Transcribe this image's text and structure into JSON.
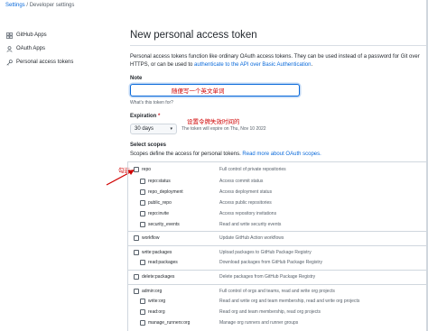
{
  "breadcrumb": {
    "settings": "Settings",
    "separator": "/",
    "current": "Developer settings"
  },
  "sidebar": {
    "items": [
      {
        "label": "GitHub Apps",
        "icon": "grid-icon"
      },
      {
        "label": "OAuth Apps",
        "icon": "person-icon"
      },
      {
        "label": "Personal access tokens",
        "icon": "key-icon"
      }
    ]
  },
  "main": {
    "title": "New personal access token",
    "intro_part1": "Personal access tokens function like ordinary OAuth access tokens. They can be used instead of a password for Git over HTTPS, or can be used to ",
    "intro_link": "authenticate to the API over Basic Authentication",
    "intro_part2": ".",
    "note_label": "Note",
    "note_value": "",
    "note_hint": "What's this token for?",
    "expiration_label": "Expiration",
    "expiration_required": "*",
    "expiration_value": "30 days",
    "expiration_text": "The token will expire on Thu, Nov 10 2022",
    "scopes_label": "Select scopes",
    "scopes_desc": "Scopes define the access for personal tokens. ",
    "scopes_link": "Read more about OAuth scopes."
  },
  "annotations": {
    "note": "随便写一个英文单词",
    "expiration": "设置令牌失效时间的",
    "check": "勾选"
  },
  "scopes": [
    {
      "name": "repo",
      "desc": "Full control of private repositories",
      "level": 0,
      "sep": true
    },
    {
      "name": "repo:status",
      "desc": "Access commit status",
      "level": 1,
      "sep": false
    },
    {
      "name": "repo_deployment",
      "desc": "Access deployment status",
      "level": 1,
      "sep": false
    },
    {
      "name": "public_repo",
      "desc": "Access public repositories",
      "level": 1,
      "sep": false
    },
    {
      "name": "repo:invite",
      "desc": "Access repository invitations",
      "level": 1,
      "sep": false
    },
    {
      "name": "security_events",
      "desc": "Read and write security events",
      "level": 1,
      "sep": false
    },
    {
      "name": "workflow",
      "desc": "Update GitHub Action workflows",
      "level": 0,
      "sep": true
    },
    {
      "name": "write:packages",
      "desc": "Upload packages to GitHub Package Registry",
      "level": 0,
      "sep": true
    },
    {
      "name": "read:packages",
      "desc": "Download packages from GitHub Package Registry",
      "level": 1,
      "sep": false
    },
    {
      "name": "delete:packages",
      "desc": "Delete packages from GitHub Package Registry",
      "level": 0,
      "sep": true
    },
    {
      "name": "admin:org",
      "desc": "Full control of orgs and teams, read and write org projects",
      "level": 0,
      "sep": true
    },
    {
      "name": "write:org",
      "desc": "Read and write org and team membership, read and write org projects",
      "level": 1,
      "sep": false
    },
    {
      "name": "read:org",
      "desc": "Read org and team membership, read org projects",
      "level": 1,
      "sep": false
    },
    {
      "name": "manage_runners:org",
      "desc": "Manage org runners and runner groups",
      "level": 1,
      "sep": false
    }
  ],
  "colors": {
    "link": "#0969da",
    "annotation": "#d00000",
    "border": "#d0d7de"
  }
}
